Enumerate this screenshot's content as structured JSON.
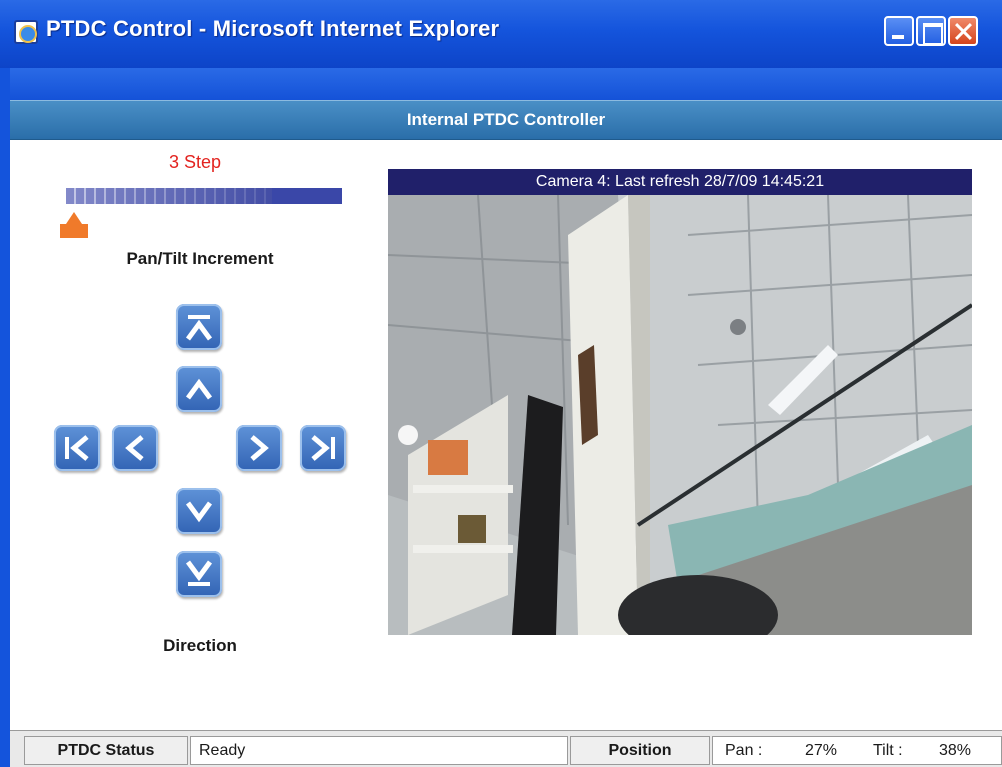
{
  "window": {
    "title": "PTDC Control - Microsoft Internet Explorer",
    "icon": "ie-page-icon",
    "controls": [
      "minimize-icon",
      "maximize-icon",
      "close-icon"
    ]
  },
  "page": {
    "header": "Internal PTDC Controller"
  },
  "increment": {
    "step_label": "3 Step",
    "label": "Pan/Tilt Increment",
    "slider_level": 0.03,
    "slider_color": "#3a47a8",
    "thumb_color": "#f07a2a"
  },
  "direction": {
    "label": "Direction",
    "buttons": [
      {
        "name": "tilt-top",
        "icon": "arrow-up-to-top-icon"
      },
      {
        "name": "tilt-up",
        "icon": "chevron-up-icon"
      },
      {
        "name": "pan-far-left",
        "icon": "arrow-left-to-start-icon"
      },
      {
        "name": "pan-left",
        "icon": "chevron-left-icon"
      },
      {
        "name": "pan-right",
        "icon": "chevron-right-icon"
      },
      {
        "name": "pan-far-right",
        "icon": "arrow-right-to-end-icon"
      },
      {
        "name": "tilt-down",
        "icon": "chevron-down-icon"
      },
      {
        "name": "tilt-bottom",
        "icon": "arrow-down-to-bottom-icon"
      }
    ],
    "button_color": "#3f72c2"
  },
  "camera": {
    "caption": "Camera 4: Last refresh 28/7/09 14:45:21",
    "caption_bg": "#20206a"
  },
  "status": {
    "label": "PTDC Status",
    "value": "Ready",
    "position_label": "Position",
    "pan_label": "Pan :",
    "pan_value": "27%",
    "tilt_label": "Tilt :",
    "tilt_value": "38%"
  }
}
